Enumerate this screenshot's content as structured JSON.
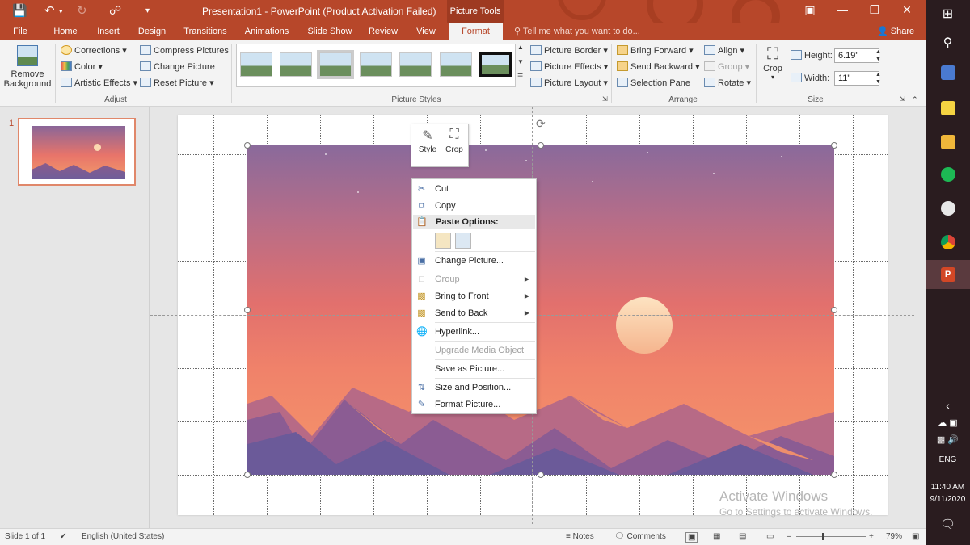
{
  "titlebar": {
    "title": "Presentation1 - PowerPoint (Product Activation Failed)",
    "context_tab": "Picture Tools",
    "qat": {
      "save_icon": "save-icon",
      "undo_icon": "undo-icon",
      "redo_icon": "redo-icon",
      "slideshow_icon": "present-icon"
    },
    "window": {
      "ribbon_display_icon": "ribbon-display-icon",
      "minimize": "—",
      "restore": "❐",
      "close": "✕"
    }
  },
  "tabs": [
    "File",
    "Home",
    "Insert",
    "Design",
    "Transitions",
    "Animations",
    "Slide Show",
    "Review",
    "View",
    "Format"
  ],
  "active_tab": "Format",
  "tell_me": "Tell me what you want to do...",
  "share": "Share",
  "ribbon": {
    "remove_background": {
      "line1": "Remove",
      "line2": "Background"
    },
    "adjust": {
      "corrections": "Corrections",
      "color": "Color",
      "artistic_effects": "Artistic Effects",
      "compress": "Compress Pictures",
      "change": "Change Picture",
      "reset": "Reset Picture",
      "label": "Adjust"
    },
    "picture_styles": {
      "label": "Picture Styles",
      "picture_border": "Picture Border",
      "picture_effects": "Picture Effects",
      "picture_layout": "Picture Layout"
    },
    "arrange": {
      "label": "Arrange",
      "bring_forward": "Bring Forward",
      "send_backward": "Send Backward",
      "selection_pane": "Selection Pane",
      "align": "Align",
      "group": "Group",
      "rotate": "Rotate"
    },
    "size": {
      "label": "Size",
      "crop": "Crop",
      "height_label": "Height:",
      "height_value": "6.19\"",
      "width_label": "Width:",
      "width_value": "11\""
    }
  },
  "thumbnail": {
    "number": "1"
  },
  "minibar": {
    "style": "Style",
    "crop": "Crop"
  },
  "context_menu": {
    "cut": "Cut",
    "copy": "Copy",
    "paste_options": "Paste Options:",
    "change_picture": "Change Picture...",
    "group": "Group",
    "bring_to_front": "Bring to Front",
    "send_to_back": "Send to Back",
    "hyperlink": "Hyperlink...",
    "upgrade_media": "Upgrade Media Object",
    "save_as_picture": "Save as Picture...",
    "size_position": "Size and Position...",
    "format_picture": "Format Picture..."
  },
  "activate": {
    "title": "Activate Windows",
    "subtitle": "Go to Settings to activate Windows."
  },
  "statusbar": {
    "slide": "Slide 1 of 1",
    "language": "English (United States)",
    "notes": "Notes",
    "comments": "Comments",
    "zoom": "79%"
  },
  "taskbar": {
    "lang": "ENG",
    "time": "11:40 AM",
    "date": "9/11/2020"
  },
  "colors": {
    "accent": "#b7472a"
  }
}
